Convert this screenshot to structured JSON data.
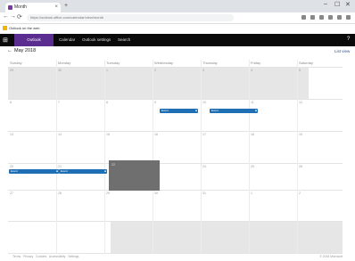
{
  "browser": {
    "tab_title": "Month",
    "new_tab_symbol": "+",
    "window_controls": [
      "–",
      "☐",
      "✕"
    ],
    "nav_symbols": [
      "←",
      "→",
      "⟳"
    ],
    "url": "https://outlook.office.com/calendar/view/month",
    "bookmark_label": "Outlook on the web"
  },
  "app": {
    "waffle_symbol": "⊞",
    "name": "Outlook",
    "header_links": [
      "Calendar",
      "Outlook settings",
      "Search"
    ],
    "header_right_symbol": "?"
  },
  "toolbar": {
    "back_symbol": "←",
    "month_title": "May 2018",
    "list_view_label": "List view"
  },
  "calendar": {
    "weekdays": [
      "Sunday",
      "Monday",
      "Tuesday",
      "Wednesday",
      "Thursday",
      "Friday",
      "Saturday"
    ],
    "weeks": [
      [
        "29",
        "30",
        "1",
        "2",
        "3",
        "4",
        "5"
      ],
      [
        "6",
        "7",
        "8",
        "9",
        "10",
        "11",
        "12"
      ],
      [
        "13",
        "14",
        "15",
        "16",
        "17",
        "18",
        "19"
      ],
      [
        "20",
        "21",
        "22",
        "23",
        "24",
        "25",
        "26"
      ],
      [
        "27",
        "28",
        "29",
        "30",
        "31",
        "1",
        "2"
      ]
    ],
    "events": [
      {
        "label": "Event",
        "icon": "■"
      },
      {
        "label": "Event",
        "icon": "■"
      },
      {
        "label": "Event",
        "icon": "■"
      },
      {
        "label": "Event",
        "icon": "■"
      }
    ]
  },
  "footer": {
    "links": [
      "Terms",
      "Privacy",
      "Cookies",
      "Accessibility",
      "Settings"
    ],
    "copyright": "© 2018 Microsoft"
  },
  "colors": {
    "brand": "#5c2d91",
    "event": "#1f6fb5",
    "header": "#0a0a0a"
  }
}
